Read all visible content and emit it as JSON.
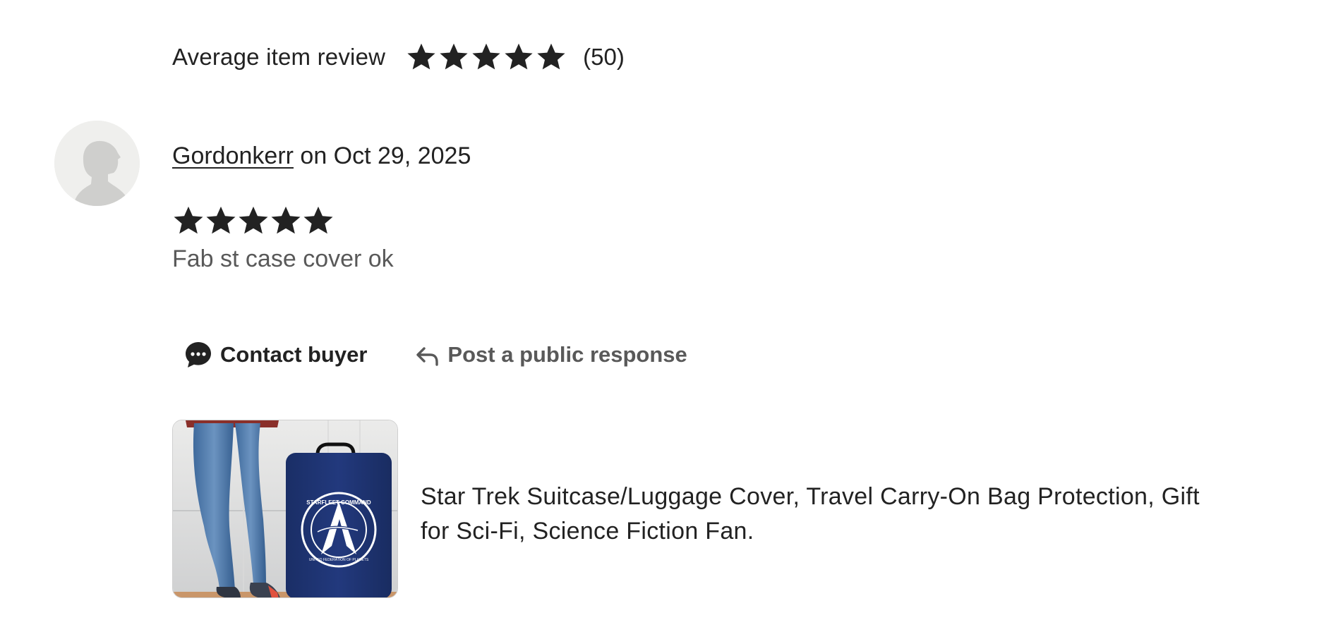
{
  "average_review": {
    "label": "Average item review",
    "rating": 5,
    "max_rating": 5,
    "count_text": "(50)"
  },
  "review": {
    "reviewer_name": "Gordonkerr",
    "date_text": " on Oct 29, 2025",
    "rating": 5,
    "max_rating": 5,
    "text": "Fab st case cover ok"
  },
  "actions": {
    "contact_label": "Contact buyer",
    "post_label": "Post a public response"
  },
  "listing": {
    "title": "Star Trek Suitcase/Luggage Cover, Travel Carry-On Bag Protection, Gift for Sci-Fi, Science Fiction Fan.",
    "image_alt": "Navy luggage cover with Starfleet Command emblem",
    "logo_text_top": "STARFLEET COMMAND",
    "logo_text_bottom": "UNITED FEDERATION OF PLANETS"
  },
  "colors": {
    "text": "#222222",
    "muted_text": "#595959",
    "suitcase_blue": "#1d3474",
    "avatar_bg": "#efefed"
  },
  "icons": [
    "star-icon",
    "chat-bubble-icon",
    "reply-arrow-icon",
    "avatar-silhouette-icon"
  ]
}
